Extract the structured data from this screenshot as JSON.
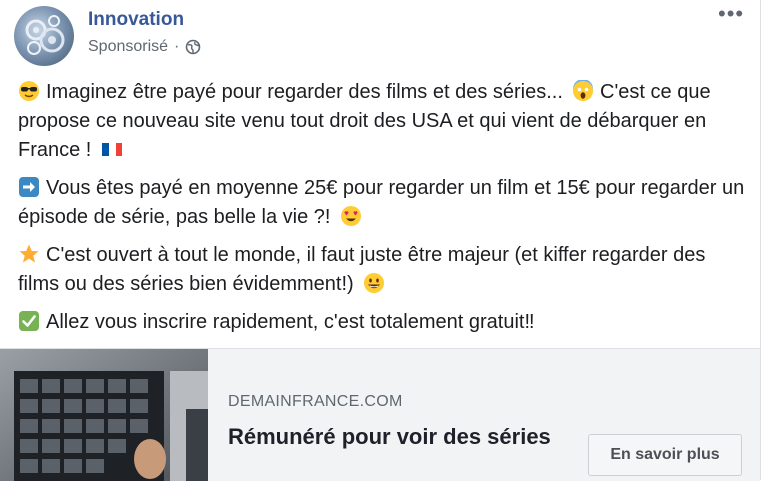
{
  "post": {
    "page_name": "Innovation",
    "sponsored_label": "Sponsorisé",
    "separator": "·",
    "privacy_icon": "globe-icon",
    "more_label": "•••",
    "paragraphs": [
      {
        "emoji_icon": "sunglasses-emoji-icon",
        "text": "Imaginez être payé pour regarder des films et des séries... ",
        "mid_emoji_icon": "scream-emoji-icon",
        "text2": " C'est ce que propose ce nouveau site venu tout droit des USA et qui vient de débarquer en France ! ",
        "end_emoji_icon": "flag-france-icon"
      },
      {
        "emoji_icon": "right-arrow-emoji-icon",
        "text": "Vous êtes payé en moyenne 25€ pour regarder un film et 15€ pour regarder un épisode de série, pas belle la vie ?! ",
        "end_emoji_icon": "heart-eyes-emoji-icon"
      },
      {
        "emoji_icon": "star-emoji-icon",
        "text": "C'est ouvert à tout le monde, il faut juste être majeur (et kiffer regarder des films ou des séries bien évidemment!) ",
        "end_emoji_icon": "grin-emoji-icon"
      },
      {
        "emoji_icon": "check-mark-emoji-icon",
        "text": "Allez vous inscrire rapidement, c'est totalement gratuit‼"
      }
    ]
  },
  "link_preview": {
    "domain": "DEMAINFRANCE.COM",
    "headline": "Rémunéré pour voir des séries",
    "cta_label": "En savoir plus",
    "thumbnail_icon": "video-wall-thumbnail"
  }
}
